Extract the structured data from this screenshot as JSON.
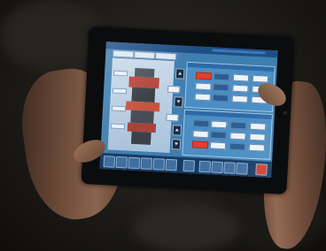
{
  "scene": {
    "subject": "",
    "colors": {
      "screen_blue": "#3f7fb0",
      "header_blue": "#1d4f85",
      "alert_red": "#e2402e",
      "skin": "#8a6450"
    }
  }
}
